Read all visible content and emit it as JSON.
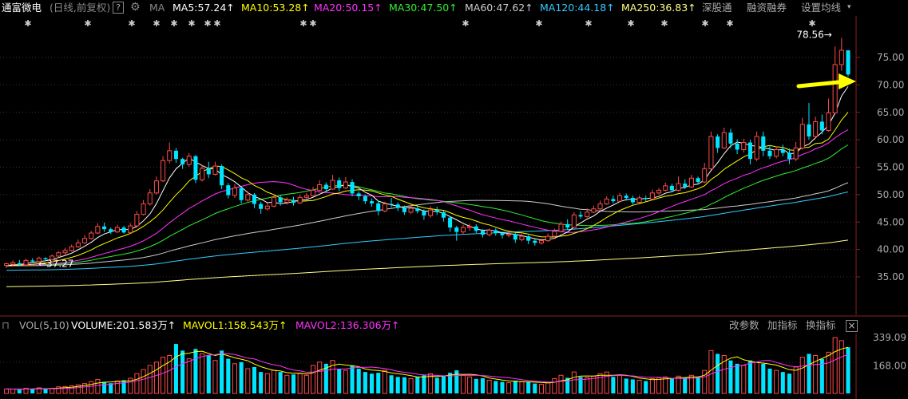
{
  "header": {
    "stock_name": "通富微电",
    "period": "(日线,前复权)",
    "help": "?",
    "indicator": "MA",
    "ma": [
      {
        "label": "MA5:57.24↑",
        "color": "#ffffff"
      },
      {
        "label": "MA10:53.28↑",
        "color": "#ffff00"
      },
      {
        "label": "MA20:50.15↑",
        "color": "#ff33ff"
      },
      {
        "label": "MA30:47.50↑",
        "color": "#33ee33"
      },
      {
        "label": "MA60:47.62↑",
        "color": "#cccccc"
      },
      {
        "label": "MA120:44.18↑",
        "color": "#33ccff"
      },
      {
        "label": "MA250:36.83↑",
        "color": "#ffff88"
      }
    ],
    "links": [
      "深股通",
      "融资融券",
      "设置均线"
    ]
  },
  "price_axis": [
    "75.00",
    "70.00",
    "65.00",
    "60.00",
    "55.00",
    "50.00",
    "45.00",
    "40.00",
    "35.00"
  ],
  "max_annotation": "78.56",
  "min_annotation": "37.27",
  "volume": {
    "name": "VOL(5,10)",
    "volume_label": "VOLUME:201.583万↑",
    "mavol1_label": "MAVOL1:158.543万↑",
    "mavol2_label": "MAVOL2:136.306万↑",
    "links": [
      "改参数",
      "加指标",
      "换指标"
    ],
    "close": "×",
    "axis": [
      "339.09",
      "168.00"
    ]
  },
  "colors": {
    "up": "#ff4a4a",
    "down": "#00e5ff",
    "ma5": "#ffffff",
    "ma10": "#ffff00",
    "ma20": "#ff33ff",
    "ma30": "#33ee33",
    "ma60": "#cccccc",
    "ma120": "#33ccff",
    "ma250": "#ffff88",
    "arrow": "#ffff00"
  },
  "chart_data": {
    "type": "candlestick",
    "price_unit": "yuan",
    "volume_unit": "万",
    "candles": [
      [
        37.1,
        37.4,
        36.6,
        37.6,
        27
      ],
      [
        37.3,
        37.6,
        37.1,
        38.0,
        26
      ],
      [
        37.5,
        37.2,
        37.0,
        38.1,
        22
      ],
      [
        37.2,
        38.0,
        37.0,
        38.3,
        31
      ],
      [
        38.0,
        37.8,
        37.5,
        38.4,
        29
      ],
      [
        37.8,
        38.4,
        37.6,
        38.7,
        34
      ],
      [
        38.4,
        38.2,
        37.9,
        38.6,
        28
      ],
      [
        38.2,
        38.8,
        38.0,
        39.1,
        30
      ],
      [
        38.8,
        39.4,
        38.6,
        39.7,
        40
      ],
      [
        39.4,
        39.8,
        39.1,
        40.3,
        42
      ],
      [
        39.8,
        40.5,
        39.6,
        40.9,
        46
      ],
      [
        40.5,
        41.2,
        40.3,
        41.8,
        52
      ],
      [
        41.2,
        42.0,
        41.0,
        42.6,
        60
      ],
      [
        42.0,
        43.0,
        41.8,
        43.4,
        72
      ],
      [
        43.0,
        44.2,
        42.8,
        44.8,
        85
      ],
      [
        44.2,
        43.7,
        43.2,
        44.9,
        70
      ],
      [
        43.7,
        43.2,
        42.8,
        44.0,
        62
      ],
      [
        43.2,
        44.0,
        43.0,
        44.5,
        75
      ],
      [
        44.0,
        43.1,
        42.9,
        44.3,
        80
      ],
      [
        43.1,
        44.3,
        42.9,
        44.8,
        92
      ],
      [
        44.3,
        46.4,
        44.0,
        47.0,
        120
      ],
      [
        46.4,
        48.3,
        46.2,
        49.0,
        145
      ],
      [
        48.3,
        50.3,
        48.0,
        51.0,
        170
      ],
      [
        50.3,
        52.5,
        50.0,
        53.3,
        190
      ],
      [
        52.5,
        56.2,
        52.3,
        57.0,
        220
      ],
      [
        56.2,
        58.0,
        55.7,
        59.5,
        230
      ],
      [
        58.0,
        56.5,
        55.8,
        58.5,
        300
      ],
      [
        56.5,
        55.5,
        54.7,
        56.7,
        260
      ],
      [
        55.5,
        57.0,
        55.1,
        57.6,
        210
      ],
      [
        57.0,
        52.7,
        52.1,
        57.2,
        270
      ],
      [
        52.7,
        54.8,
        52.4,
        55.4,
        240
      ],
      [
        54.8,
        53.7,
        53.0,
        56.0,
        230
      ],
      [
        53.7,
        55.2,
        53.5,
        56.0,
        200
      ],
      [
        55.2,
        51.7,
        51.0,
        55.5,
        260
      ],
      [
        51.7,
        49.9,
        49.3,
        52.1,
        210
      ],
      [
        49.9,
        51.2,
        49.4,
        51.9,
        180
      ],
      [
        51.2,
        49.0,
        48.4,
        51.4,
        190
      ],
      [
        49.0,
        50.0,
        48.7,
        50.6,
        150
      ],
      [
        50.0,
        48.3,
        47.5,
        50.3,
        160
      ],
      [
        48.3,
        47.4,
        46.5,
        48.7,
        130
      ],
      [
        47.4,
        47.9,
        47.1,
        48.5,
        120
      ],
      [
        47.9,
        49.5,
        47.7,
        50.1,
        140
      ],
      [
        49.5,
        48.6,
        48.0,
        50.0,
        130
      ],
      [
        48.6,
        49.0,
        48.2,
        49.5,
        110
      ],
      [
        49.0,
        48.5,
        48.0,
        49.6,
        115
      ],
      [
        48.5,
        49.5,
        48.3,
        50.0,
        120
      ],
      [
        49.5,
        49.8,
        49.2,
        50.3,
        110
      ],
      [
        49.8,
        50.8,
        49.6,
        51.4,
        170
      ],
      [
        50.8,
        51.8,
        50.6,
        52.6,
        190
      ],
      [
        51.8,
        51.0,
        50.5,
        52.2,
        180
      ],
      [
        51.0,
        52.6,
        50.9,
        53.6,
        200
      ],
      [
        52.6,
        51.2,
        50.6,
        53.1,
        150
      ],
      [
        51.2,
        52.3,
        51.0,
        53.2,
        140
      ],
      [
        52.3,
        50.2,
        49.7,
        52.8,
        170
      ],
      [
        50.2,
        49.7,
        49.0,
        50.6,
        150
      ],
      [
        49.7,
        48.8,
        48.3,
        50.0,
        130
      ],
      [
        48.8,
        48.4,
        47.8,
        49.3,
        120
      ],
      [
        48.4,
        47.0,
        46.2,
        48.9,
        125
      ],
      [
        47.0,
        48.3,
        46.8,
        48.7,
        140
      ],
      [
        48.3,
        48.2,
        47.7,
        49.4,
        110
      ],
      [
        48.2,
        47.6,
        47.0,
        48.6,
        100
      ],
      [
        47.6,
        46.8,
        46.3,
        48.0,
        98
      ],
      [
        46.8,
        47.5,
        46.5,
        48.1,
        90
      ],
      [
        47.5,
        47.0,
        46.6,
        47.9,
        100
      ],
      [
        47.0,
        46.2,
        45.4,
        47.3,
        110
      ],
      [
        46.2,
        47.2,
        45.8,
        47.9,
        120
      ],
      [
        47.2,
        46.8,
        46.3,
        47.8,
        95
      ],
      [
        46.8,
        45.8,
        45.1,
        47.1,
        105
      ],
      [
        45.8,
        44.0,
        43.2,
        46.0,
        125
      ],
      [
        44.0,
        43.2,
        41.6,
        44.3,
        140
      ],
      [
        43.2,
        44.0,
        42.8,
        44.5,
        110
      ],
      [
        44.0,
        44.2,
        43.4,
        44.7,
        100
      ],
      [
        44.2,
        43.4,
        43.0,
        44.6,
        88
      ],
      [
        43.4,
        42.7,
        42.2,
        43.7,
        92
      ],
      [
        42.7,
        43.5,
        42.4,
        43.8,
        80
      ],
      [
        43.5,
        43.0,
        42.5,
        43.9,
        75
      ],
      [
        43.0,
        42.6,
        42.0,
        43.2,
        70
      ],
      [
        42.6,
        42.8,
        42.2,
        43.3,
        65
      ],
      [
        42.8,
        41.8,
        41.2,
        43.0,
        78
      ],
      [
        41.8,
        42.4,
        41.5,
        42.8,
        70
      ],
      [
        42.4,
        41.6,
        41.0,
        42.6,
        68
      ],
      [
        41.6,
        41.2,
        40.7,
        41.9,
        60
      ],
      [
        41.2,
        41.6,
        40.9,
        42.0,
        55
      ],
      [
        41.6,
        42.4,
        41.4,
        42.9,
        65
      ],
      [
        42.4,
        43.3,
        42.2,
        43.8,
        90
      ],
      [
        43.3,
        44.6,
        43.1,
        45.1,
        110
      ],
      [
        44.6,
        44.0,
        43.6,
        45.5,
        95
      ],
      [
        44.0,
        46.3,
        43.8,
        46.8,
        130
      ],
      [
        46.3,
        46.0,
        45.6,
        47.0,
        100
      ],
      [
        46.0,
        46.8,
        45.8,
        47.5,
        95
      ],
      [
        46.8,
        47.4,
        46.6,
        48.0,
        105
      ],
      [
        47.4,
        48.3,
        47.2,
        48.9,
        120
      ],
      [
        48.3,
        49.2,
        48.1,
        49.7,
        130
      ],
      [
        49.2,
        48.8,
        48.4,
        49.8,
        100
      ],
      [
        48.8,
        49.8,
        48.6,
        50.3,
        110
      ],
      [
        49.8,
        49.4,
        48.9,
        50.2,
        90
      ],
      [
        49.4,
        48.6,
        48.2,
        49.8,
        85
      ],
      [
        48.6,
        49.4,
        48.4,
        49.8,
        80
      ],
      [
        49.4,
        49.2,
        48.8,
        49.8,
        75
      ],
      [
        49.2,
        50.3,
        49.0,
        50.9,
        90
      ],
      [
        50.3,
        50.8,
        50.0,
        51.2,
        95
      ],
      [
        50.8,
        51.6,
        50.6,
        52.2,
        100
      ],
      [
        51.6,
        50.8,
        50.4,
        52.0,
        88
      ],
      [
        50.8,
        52.0,
        50.6,
        53.3,
        105
      ],
      [
        52.0,
        51.4,
        51.0,
        52.8,
        95
      ],
      [
        51.4,
        53.0,
        51.2,
        53.6,
        110
      ],
      [
        53.0,
        52.3,
        51.9,
        53.3,
        100
      ],
      [
        52.3,
        54.7,
        52.1,
        55.8,
        140
      ],
      [
        54.7,
        60.6,
        54.5,
        61.5,
        260
      ],
      [
        60.6,
        58.5,
        57.6,
        61.0,
        240
      ],
      [
        58.5,
        61.3,
        58.3,
        62.2,
        230
      ],
      [
        61.3,
        59.3,
        58.5,
        62.0,
        200
      ],
      [
        59.3,
        58.2,
        57.4,
        60.1,
        180
      ],
      [
        58.2,
        59.5,
        57.7,
        60.2,
        170
      ],
      [
        59.5,
        56.5,
        55.5,
        60.0,
        200
      ],
      [
        56.5,
        60.6,
        56.1,
        61.5,
        190
      ],
      [
        60.6,
        58.0,
        57.0,
        61.5,
        180
      ],
      [
        58.0,
        57.0,
        56.5,
        59.0,
        150
      ],
      [
        57.0,
        58.2,
        56.6,
        58.8,
        140
      ],
      [
        58.2,
        57.6,
        57.0,
        59.1,
        130
      ],
      [
        57.6,
        56.5,
        55.6,
        58.4,
        120
      ],
      [
        56.5,
        58.5,
        56.1,
        59.6,
        160
      ],
      [
        58.5,
        62.8,
        58.2,
        64.0,
        220
      ],
      [
        62.8,
        60.6,
        60.0,
        66.7,
        240
      ],
      [
        60.6,
        63.3,
        60.2,
        64.2,
        230
      ],
      [
        63.3,
        61.7,
        61.0,
        64.6,
        210
      ],
      [
        61.7,
        64.9,
        61.5,
        67.5,
        250
      ],
      [
        64.9,
        73.7,
        64.7,
        77.0,
        339
      ],
      [
        73.7,
        76.3,
        72.6,
        78.56,
        320
      ],
      [
        76.3,
        71.9,
        71.5,
        75.6,
        280
      ]
    ]
  }
}
